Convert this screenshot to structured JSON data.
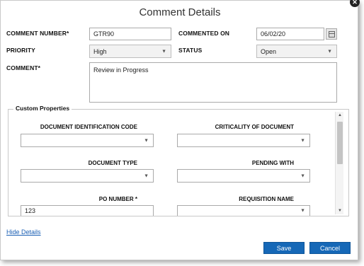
{
  "dialog": {
    "title": "Comment Details"
  },
  "fields": {
    "comment_number": {
      "label": "COMMENT NUMBER*",
      "value": "GTR90"
    },
    "commented_on": {
      "label": "COMMENTED ON",
      "value": "06/02/20"
    },
    "priority": {
      "label": "PRIORITY",
      "value": "High"
    },
    "status": {
      "label": "STATUS",
      "value": "Open"
    },
    "comment": {
      "label": "COMMENT*",
      "value": "Review in Progress"
    }
  },
  "custom_properties": {
    "legend": "Custom Properties",
    "document_identification_code": {
      "label": "DOCUMENT IDENTIFICATION CODE",
      "value": ""
    },
    "criticality_of_document": {
      "label": "CRITICALITY OF DOCUMENT",
      "value": ""
    },
    "document_type": {
      "label": "DOCUMENT TYPE",
      "value": ""
    },
    "pending_with": {
      "label": "PENDING WITH",
      "value": ""
    },
    "po_number": {
      "label": "PO NUMBER *",
      "value": "123"
    },
    "requisition_name": {
      "label": "REQUISITION NAME",
      "value": ""
    }
  },
  "footer": {
    "hide_details": "Hide Details",
    "save": "Save",
    "cancel": "Cancel"
  },
  "icons": {
    "dropdown": "▼",
    "close": "✕",
    "scroll_up": "▲",
    "scroll_down": "▼"
  },
  "colors": {
    "primary_button": "#1668b7",
    "link": "#1a5fb4"
  }
}
